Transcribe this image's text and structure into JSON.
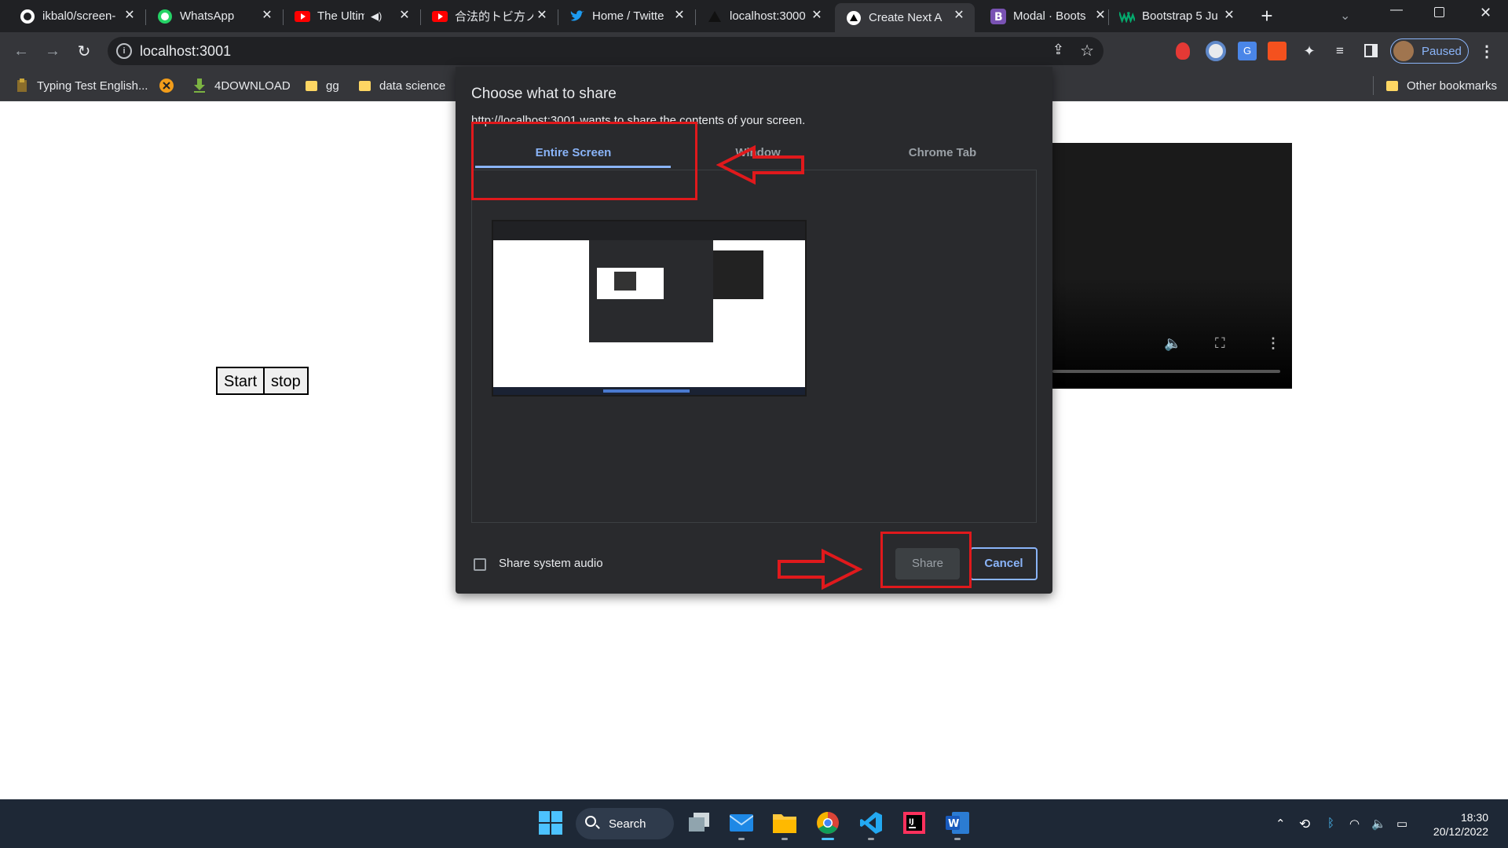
{
  "browser": {
    "tabs": [
      {
        "title": "ikbal0/screen-",
        "icon": "github-icon"
      },
      {
        "title": "WhatsApp",
        "icon": "whatsapp-icon"
      },
      {
        "title": "The Ultim",
        "icon": "youtube-icon"
      },
      {
        "title": "合法的トビ方ノ",
        "icon": "youtube-icon"
      },
      {
        "title": "Home / Twitte",
        "icon": "twitter-icon"
      },
      {
        "title": "localhost:3000",
        "icon": "vercel-icon"
      },
      {
        "title": "Create Next A",
        "icon": "nextjs-icon"
      },
      {
        "title": "Modal · Boots",
        "icon": "bootstrap-icon"
      },
      {
        "title": "Bootstrap 5 Ju",
        "icon": "w3schools-icon"
      }
    ],
    "active_tab_index": 6,
    "new_tab_icon": "+",
    "url": "localhost:3001",
    "profile_status": "Paused",
    "bookmarks": [
      "Typing Test English...",
      "4DOWNLOAD",
      "gg",
      "data science"
    ],
    "other_bookmarks": "Other bookmarks"
  },
  "page": {
    "start_label": "Start",
    "stop_label": "stop"
  },
  "dialog": {
    "title": "Choose what to share",
    "subtitle": "http://localhost:3001 wants to share the contents of your screen.",
    "tabs": [
      "Entire Screen",
      "Window",
      "Chrome Tab"
    ],
    "selected_tab": "Entire Screen",
    "audio_label": "Share system audio",
    "share_label": "Share",
    "cancel_label": "Cancel"
  },
  "taskbar": {
    "search_label": "Search",
    "time": "18:30",
    "date": "20/12/2022"
  },
  "colors": {
    "annotation_red": "#e0191c",
    "accent_blue": "#8ab4f8",
    "dialog_bg": "#292a2d"
  }
}
